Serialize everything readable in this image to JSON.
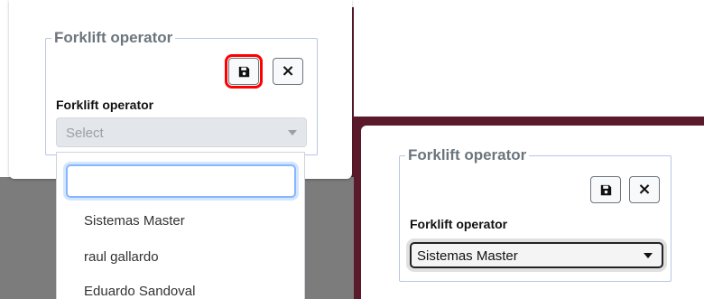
{
  "left_panel": {
    "legend": "Forklift operator",
    "field_label": "Forklift operator",
    "select_placeholder": "Select",
    "dropdown": {
      "search_value": "",
      "options": [
        "Sistemas Master",
        "raul gallardo",
        "Eduardo Sandoval"
      ]
    }
  },
  "right_panel": {
    "legend": "Forklift operator",
    "field_label": "Forklift operator",
    "selected_value": "Sistemas Master"
  },
  "icons": {
    "save": "floppy-disk-icon",
    "cancel": "close-icon"
  },
  "colors": {
    "highlight": "#ff0000",
    "background_accent": "#5a1a2b",
    "focus_ring": "#86b7fe"
  }
}
